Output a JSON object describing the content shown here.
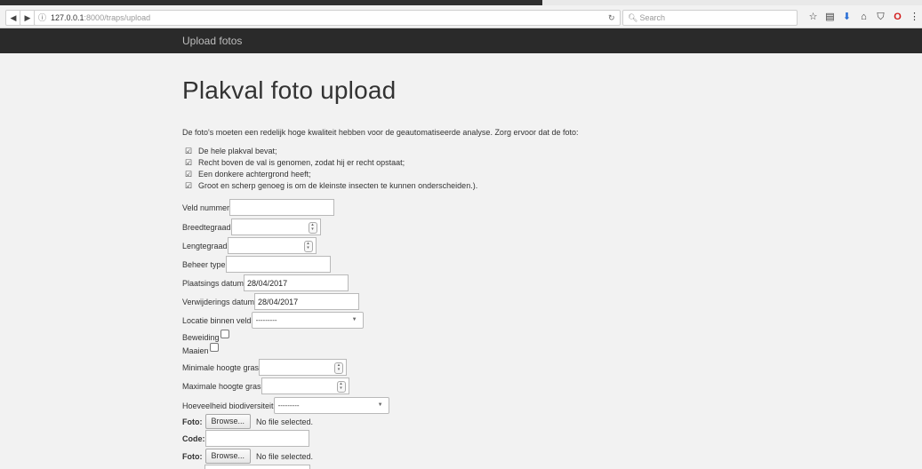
{
  "browser": {
    "url_host": "127.0.0.1",
    "url_path": ":8000/traps/upload",
    "search_placeholder": "Search"
  },
  "navbar": {
    "brand": "Upload fotos"
  },
  "page": {
    "title": "Plakval foto upload",
    "intro": "De foto's moeten een redelijk hoge kwaliteit hebben voor de geautomatiseerde analyse. Zorg ervoor dat de foto:",
    "checks": [
      "De hele plakval bevat;",
      "Recht boven de val is genomen, zodat hij er recht opstaat;",
      "Een donkere achtergrond heeft;",
      "Groot en scherp genoeg is om de kleinste insecten te kunnen onderscheiden.)."
    ]
  },
  "form": {
    "veld_nummer": {
      "label": "Veld nummer",
      "value": ""
    },
    "breedtegraad": {
      "label": "Breedtegraad",
      "value": ""
    },
    "lengtegraad": {
      "label": "Lengtegraad",
      "value": ""
    },
    "beheer_type": {
      "label": "Beheer type",
      "value": ""
    },
    "plaatsings_datum": {
      "label": "Plaatsings datum",
      "value": "28/04/2017"
    },
    "verwijderings_datum": {
      "label": "Verwijderings datum",
      "value": "28/04/2017"
    },
    "locatie": {
      "label": "Locatie binnen veld",
      "selected": "---------"
    },
    "beweiding": {
      "label": "Beweiding"
    },
    "maaien": {
      "label": "Maaien"
    },
    "min_hoogte": {
      "label": "Minimale hoogte gras",
      "value": ""
    },
    "max_hoogte": {
      "label": "Maximale hoogte gras",
      "value": ""
    },
    "biodiversiteit": {
      "label": "Hoeveelheid biodiversiteit",
      "selected": "---------"
    },
    "foto1": {
      "label": "Foto:",
      "button": "Browse...",
      "status": "No file selected."
    },
    "code1": {
      "label": "Code:",
      "value": ""
    },
    "foto2": {
      "label": "Foto:",
      "button": "Browse...",
      "status": "No file selected."
    }
  }
}
